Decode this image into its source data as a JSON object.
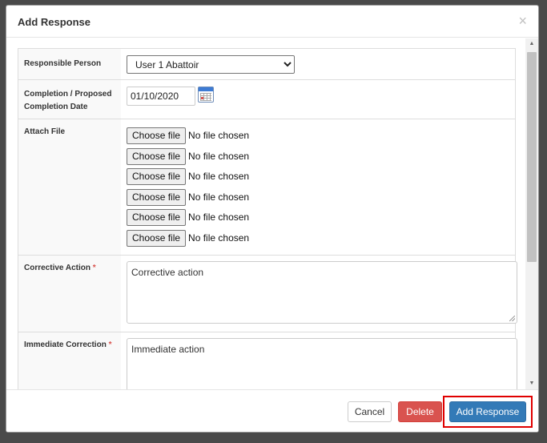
{
  "modal": {
    "title": "Add Response",
    "close_glyph": "×"
  },
  "form": {
    "responsible_person": {
      "label": "Responsible Person",
      "selected": "User 1 Abattoir"
    },
    "completion_date": {
      "label_line1": "Completion / Proposed",
      "label_line2": "Completion Date",
      "value": "01/10/2020",
      "icon": "calendar-icon"
    },
    "attach_file": {
      "label": "Attach File",
      "files": [
        {
          "button": "Choose file",
          "status": "No file chosen"
        },
        {
          "button": "Choose file",
          "status": "No file chosen"
        },
        {
          "button": "Choose file",
          "status": "No file chosen"
        },
        {
          "button": "Choose file",
          "status": "No file chosen"
        },
        {
          "button": "Choose file",
          "status": "No file chosen"
        },
        {
          "button": "Choose file",
          "status": "No file chosen"
        }
      ]
    },
    "corrective_action": {
      "label": "Corrective Action",
      "required_mark": "*",
      "value": "Corrective action"
    },
    "immediate_correction": {
      "label": "Immediate Correction",
      "required_mark": "*",
      "value": "Immediate action"
    }
  },
  "footer": {
    "cancel_label": "Cancel",
    "delete_label": "Delete",
    "add_label": "Add Response"
  },
  "colors": {
    "primary": "#337ab7",
    "danger": "#d9534f",
    "highlight": "#e00000"
  }
}
